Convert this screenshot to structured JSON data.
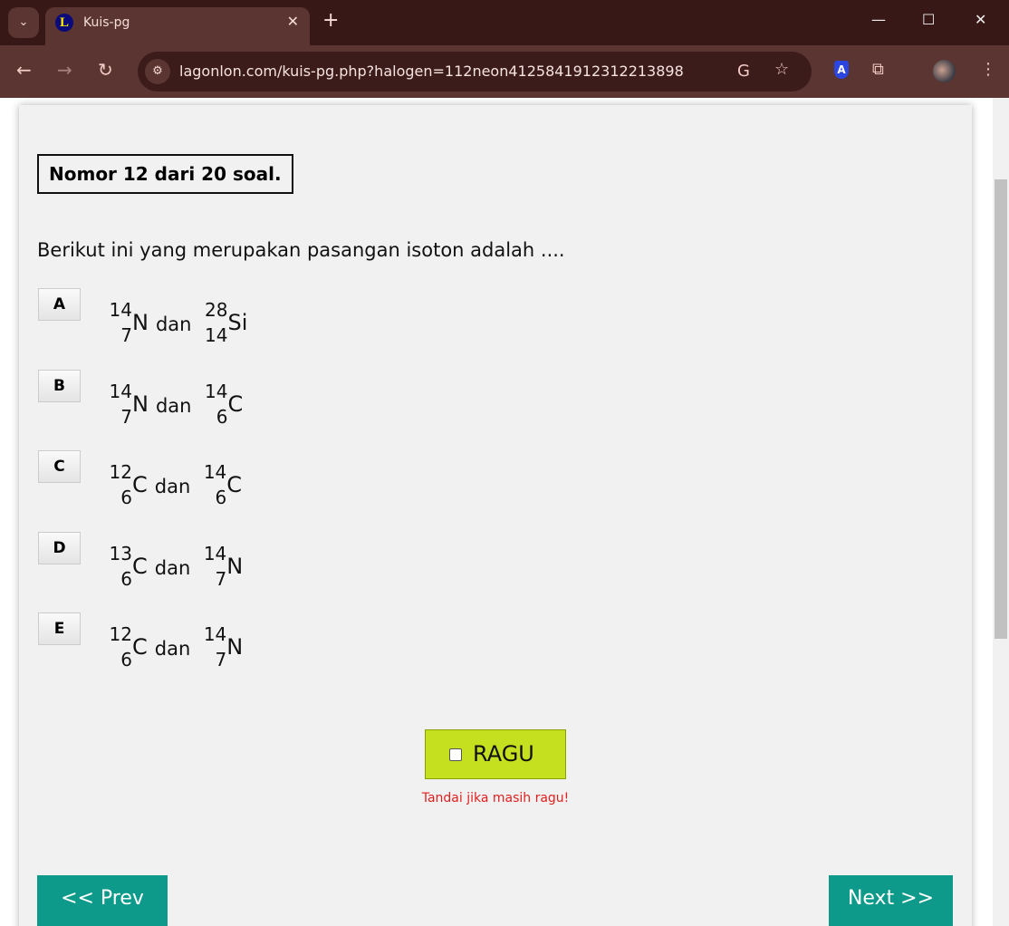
{
  "browser": {
    "tab_title": "Kuis-pg",
    "url": "lagonlon.com/kuis-pg.php?halogen=112neon4125841912312213898"
  },
  "quiz": {
    "counter": "Nomor 12 dari 20 soal.",
    "question": "Berikut ini yang merupakan pasangan isoton adalah ....",
    "connector": "dan",
    "options": [
      {
        "letter": "A",
        "a": {
          "mass": "14",
          "atomic": "7",
          "symbol": "N"
        },
        "b": {
          "mass": "28",
          "atomic": "14",
          "symbol": "Si"
        }
      },
      {
        "letter": "B",
        "a": {
          "mass": "14",
          "atomic": "7",
          "symbol": "N"
        },
        "b": {
          "mass": "14",
          "atomic": "6",
          "symbol": "C"
        }
      },
      {
        "letter": "C",
        "a": {
          "mass": "12",
          "atomic": "6",
          "symbol": "C"
        },
        "b": {
          "mass": "14",
          "atomic": "6",
          "symbol": "C"
        }
      },
      {
        "letter": "D",
        "a": {
          "mass": "13",
          "atomic": "6",
          "symbol": "C"
        },
        "b": {
          "mass": "14",
          "atomic": "7",
          "symbol": "N"
        }
      },
      {
        "letter": "E",
        "a": {
          "mass": "12",
          "atomic": "6",
          "symbol": "C"
        },
        "b": {
          "mass": "14",
          "atomic": "7",
          "symbol": "N"
        }
      }
    ],
    "ragu_label": "RAGU",
    "ragu_hint": "Tandai jika masih ragu!",
    "prev_label": "<<  Prev",
    "next_label": "Next >>"
  },
  "colors": {
    "ragu": "#c5e01e",
    "nav_button": "#0e9a8a",
    "hint": "#e02020"
  }
}
